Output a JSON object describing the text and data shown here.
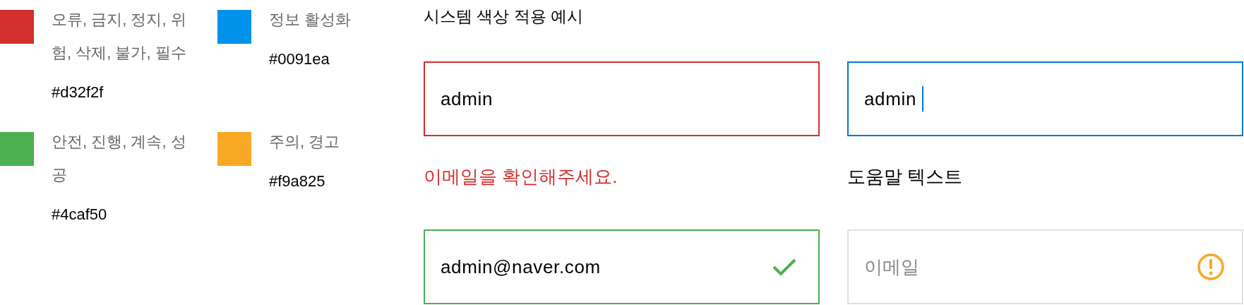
{
  "legend": [
    {
      "color": "#d32f2f",
      "label": "오류, 금지, 정지, 위험, 삭제, 불가, 필수",
      "hex": "#d32f2f"
    },
    {
      "color": "#0091ea",
      "label": "정보 활성화",
      "hex": "#0091ea"
    },
    {
      "color": "#4caf50",
      "label": "안전, 진행, 계속, 성공",
      "hex": "#4caf50"
    },
    {
      "color": "#f9a825",
      "label": "주의, 경고",
      "hex": "#f9a825"
    }
  ],
  "example": {
    "title": "시스템 색상 적용 예시",
    "fields": [
      {
        "kind": "error",
        "color": "#d32f2f",
        "value": "admin",
        "helper": "이메일을 확인해주세요."
      },
      {
        "kind": "focus",
        "color": "#0078d7",
        "value": "admin",
        "helper": "도움말 텍스트"
      },
      {
        "kind": "success",
        "color": "#4caf50",
        "value": "admin@naver.com"
      },
      {
        "kind": "warning",
        "color": "#e0e0e0",
        "placeholder": "이메일"
      }
    ]
  }
}
